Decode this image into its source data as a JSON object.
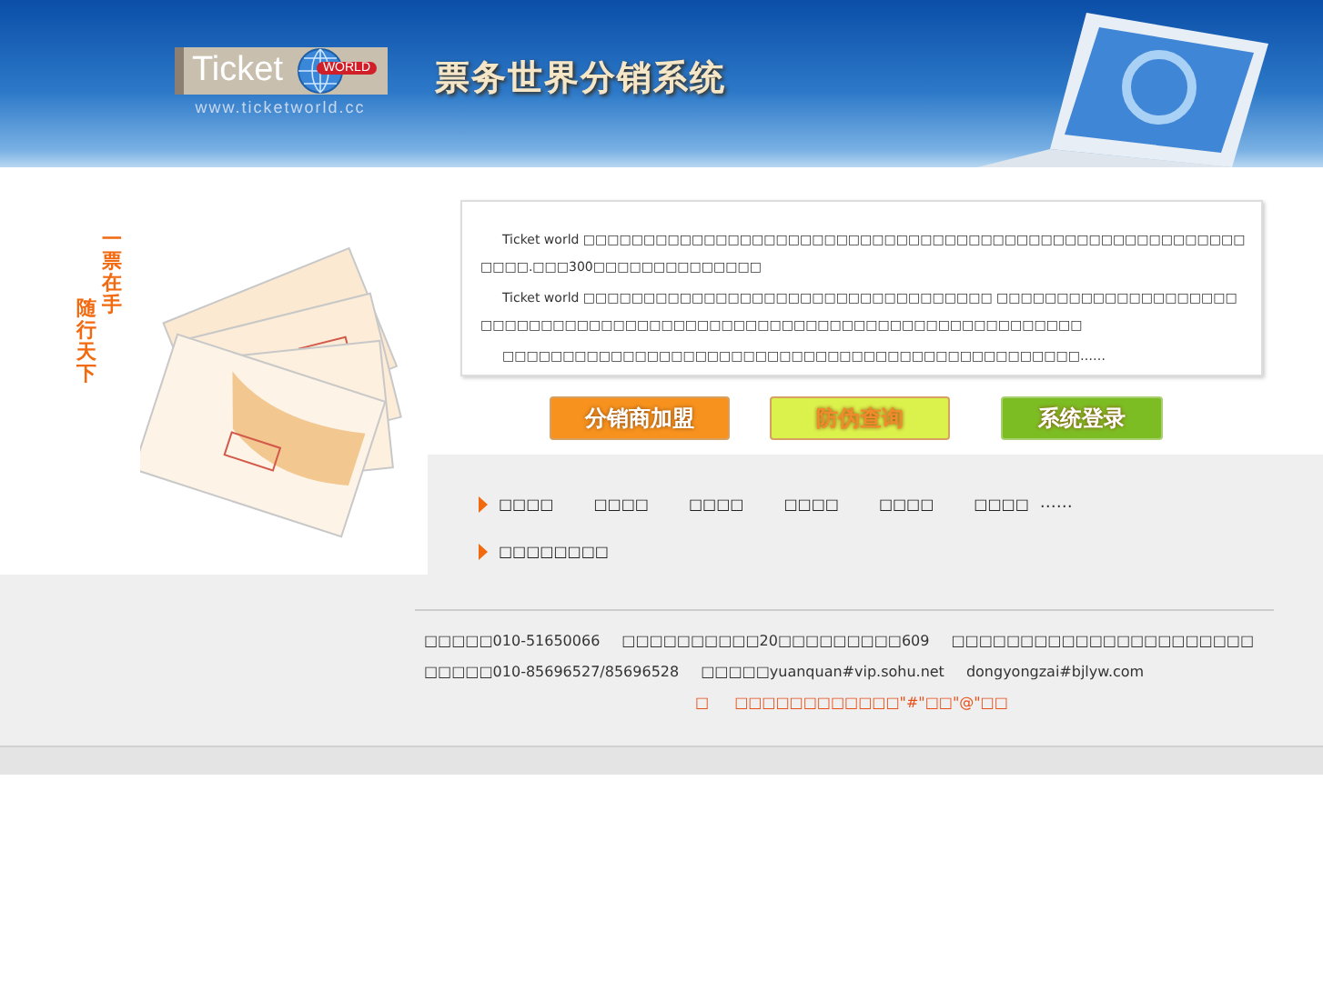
{
  "banner": {
    "logo_text": "Ticket",
    "logo_badge": "WORLD",
    "url": "www.ticketworld.cc",
    "title": "票务世界分销系统"
  },
  "promo": {
    "slogan_first": "一票在手",
    "slogan_second": "随行天下"
  },
  "intro": [
    "Ticket world □□□□□□□□□□□□□□□□□□□□□□□□□□□□□□□□□□□□□□□□□□□□□□□□□□□□□□□□□□□.□□□300□□□□□□□□□□□□□□",
    "Ticket world □□□□□□□□□□□□□□□□□□□□□□□□□□□□□□□□□□ □□□□□□□□□□□□□□□□□□□□□□□□□□□□□□□□□□□□□□□□□□□□□□□□□□□□□□□□□□□□□□□□□□□□□□",
    "□□□□□□□□□□□□□□□□□□□□□□□□□□□□□□□□□□□□□□□□□□□□□□□□……"
  ],
  "buttons": [
    {
      "label": "分销商加盟",
      "color": "#f7921e"
    },
    {
      "label": "防伪查询",
      "color": "#dcf24c"
    },
    {
      "label": "系统登录",
      "color": "#7cbd24"
    }
  ],
  "nav": [
    {
      "items": [
        "□□□□",
        "□□□□",
        "□□□□",
        "□□□□",
        "□□□□",
        "□□□□"
      ],
      "more": "……"
    },
    {
      "items": [
        "□□□□□□□□"
      ]
    }
  ],
  "contact": [
    {
      "kind": "plain",
      "parts": [
        "□□□□□010-51650066",
        "□□□□□□□□□□20□□□□□□□□□609",
        "□□□□□□□□□□□□□□□□□□□□□□"
      ]
    },
    {
      "kind": "plain",
      "parts": [
        "□□□□□010-85696527/85696528",
        "□□□□□yuanquan#vip.sohu.net",
        "dongyongzai#bjlyw.com"
      ]
    },
    {
      "kind": "note",
      "parts": [
        "□",
        "□□□□□□□□□□□□\"#\"□□\"@\"□□"
      ]
    }
  ]
}
